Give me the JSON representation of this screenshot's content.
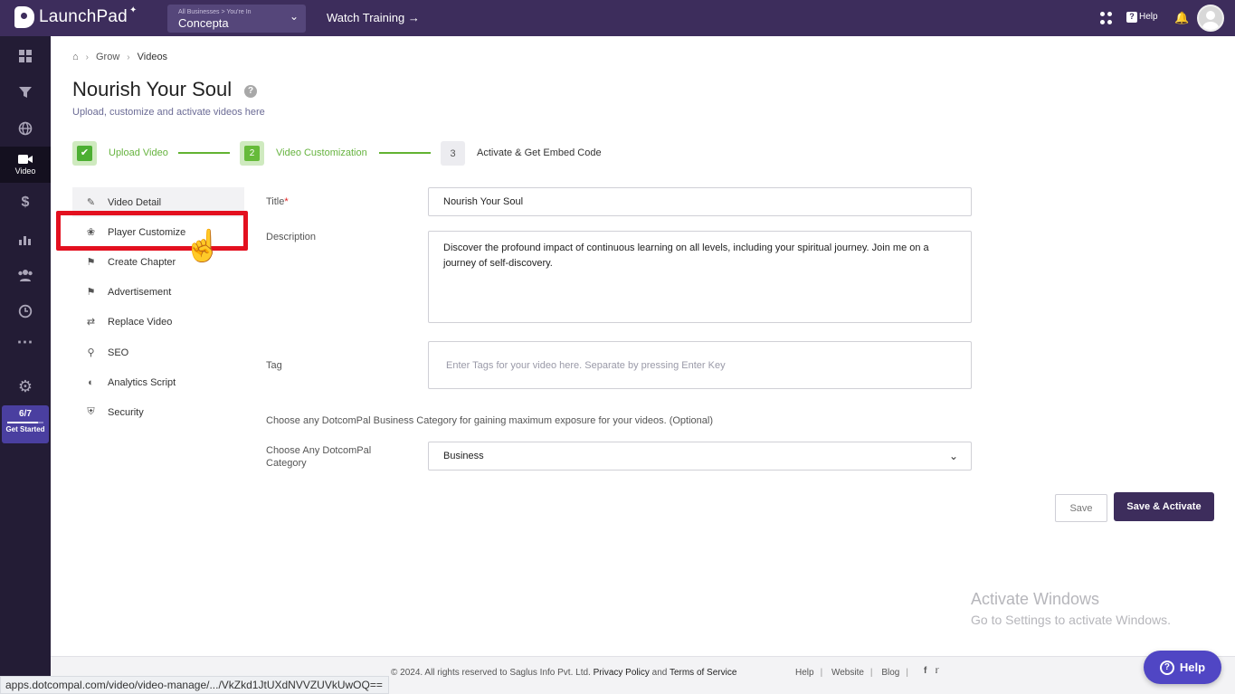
{
  "header": {
    "logo_text": "LaunchPad",
    "business_small": "All Businesses > You're In",
    "business_name": "Concepta",
    "watch_training": "Watch Training →",
    "help": "Help"
  },
  "rail": {
    "items": [
      {
        "icon": "dashboard-icon"
      },
      {
        "icon": "funnel-icon"
      },
      {
        "icon": "globe-icon"
      },
      {
        "icon": "video-camera-icon",
        "label": "Video"
      },
      {
        "icon": "dollar-icon"
      },
      {
        "icon": "analytics-icon"
      },
      {
        "icon": "users-icon"
      },
      {
        "icon": "history-icon"
      },
      {
        "icon": "more-icon"
      },
      {
        "icon": "settings-icon"
      }
    ],
    "progress": "6/7",
    "progress_fraction": 0.857,
    "get_started": "Get Started"
  },
  "breadcrumb": {
    "items": [
      "Grow",
      "Videos"
    ]
  },
  "page": {
    "title": "Nourish Your Soul",
    "subtitle": "Upload, customize and activate videos here"
  },
  "stepper": {
    "steps": [
      {
        "number": "✔",
        "label": "Upload Video",
        "state": "done"
      },
      {
        "number": "2",
        "label": "Video Customization",
        "state": "current"
      },
      {
        "number": "3",
        "label": "Activate & Get Embed Code",
        "state": "todo"
      }
    ]
  },
  "submenu": {
    "items": [
      {
        "label": "Video Detail",
        "icon": "edit-icon"
      },
      {
        "label": "Player Customize",
        "icon": "palette-icon"
      },
      {
        "label": "Create Chapter",
        "icon": "megaphone-icon"
      },
      {
        "label": "Advertisement",
        "icon": "megaphone-icon"
      },
      {
        "label": "Replace Video",
        "icon": "swap-icon"
      },
      {
        "label": "SEO",
        "icon": "search-icon"
      },
      {
        "label": "Analytics Script",
        "icon": "chart-icon"
      },
      {
        "label": "Security",
        "icon": "shield-icon"
      }
    ]
  },
  "form": {
    "title_label": "Title",
    "title_required": "*",
    "title_value": "Nourish Your Soul",
    "description_label": "Description",
    "description_value": "Discover the profound impact of continuous learning on all levels, including your spiritual journey. Join me on a journey of self-discovery.",
    "tag_label": "Tag",
    "tag_placeholder": "Enter Tags for your video here. Separate by pressing Enter Key",
    "category_note": "Choose any DotcomPal Business Category for gaining maximum exposure for your videos. (Optional)",
    "category_label": "Choose Any DotcomPal Category",
    "category_value": "Business",
    "save": "Save",
    "save_activate": "Save & Activate"
  },
  "watermark": {
    "title": "Activate Windows",
    "subtitle": "Go to Settings to activate Windows."
  },
  "footer": {
    "copyright": "©  2024. All rights reserved to Saglus Info Pvt. Ltd.",
    "privacy": "Privacy Policy",
    "and": "and",
    "terms": "Terms of Service",
    "links": [
      "Help",
      "Website",
      "Blog"
    ]
  },
  "status_url": "apps.dotcompal.com/video/video-manage/.../VkZkd1JtUXdNVVZUVkUwOQ==",
  "help_fab": "Help"
}
